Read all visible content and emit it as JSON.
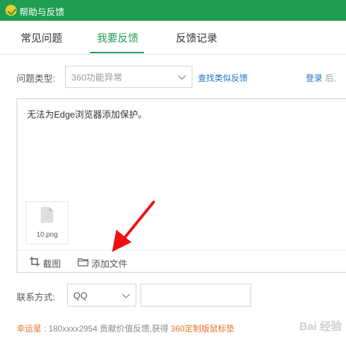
{
  "window": {
    "title": "帮助与反馈"
  },
  "tabs": [
    {
      "label": "常见问题"
    },
    {
      "label": "我要反馈"
    },
    {
      "label": "反馈记录"
    }
  ],
  "form": {
    "problem_type_label": "问题类型:",
    "problem_type_value": "360功能异常",
    "find_similar_link": "查找类似反馈",
    "login_link": "登录",
    "login_suffix": "后,",
    "description_text": "无法为Edge浏览器添加保护。",
    "attachment_name": "10.png",
    "screenshot_button": "截图",
    "add_file_button": "添加文件",
    "contact_label": "联系方式:",
    "contact_type_value": "QQ",
    "contact_value": ""
  },
  "footer": {
    "lucky_label": "幸运星",
    "sep": ":",
    "message": "180xxxx2954 贡献价值反馈,获得",
    "prize": "360定制版鼠标垫"
  },
  "watermark": "Bai 经验"
}
